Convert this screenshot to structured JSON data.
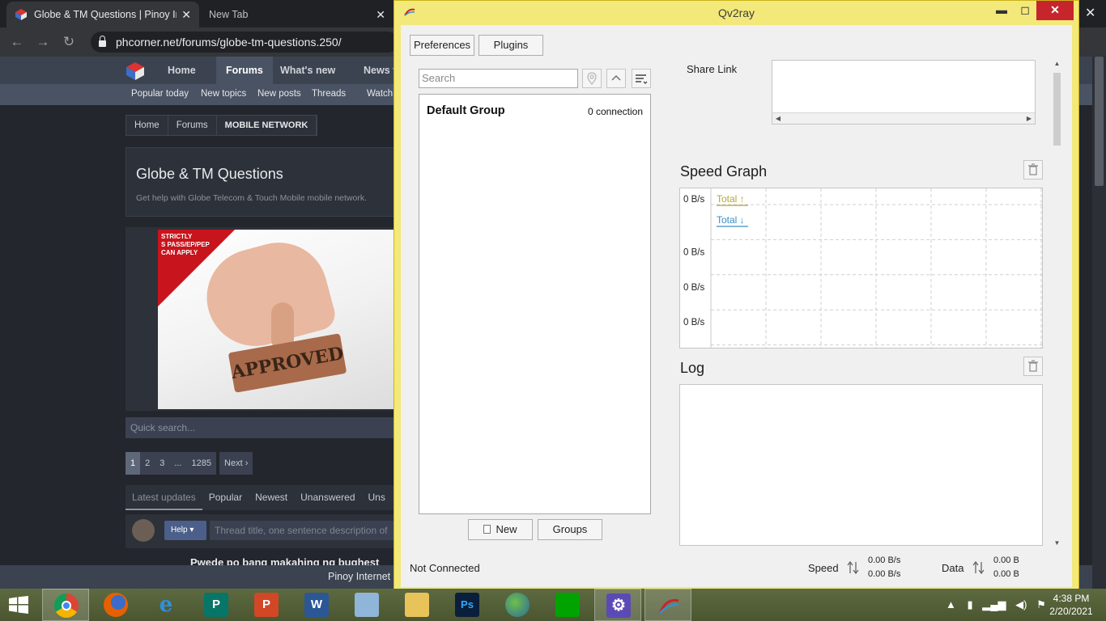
{
  "browser": {
    "tabs": [
      {
        "title": "Globe & TM Questions | Pinoy In",
        "close": "✕"
      },
      {
        "title": "New Tab",
        "close": "✕"
      }
    ],
    "url": "phcorner.net/forums/globe-tm-questions.250/",
    "nav": {
      "back": "←",
      "forward": "→",
      "reload": "↻"
    }
  },
  "site": {
    "nav": [
      "Home",
      "Forums",
      "What's new",
      "News f"
    ],
    "subnav": [
      "Popular today",
      "New topics",
      "New posts",
      "Threads",
      "Watch"
    ],
    "breadcrumb": [
      "Home",
      "Forums",
      "MOBILE NETWORK"
    ],
    "forum_title": "Globe & TM Questions",
    "forum_desc": "Get help with Globe Telecom & Touch Mobile mobile network.",
    "banner_text": "STRICTLY\nS PASS/EP/PEP\nCAN APPLY",
    "banner_stamp": "APPROVED",
    "quick_search": "Quick search...",
    "pages": [
      "1",
      "2",
      "3",
      "...",
      "1285"
    ],
    "next": "Next ›",
    "latest_tabs": [
      "Latest updates",
      "Popular",
      "Newest",
      "Unanswered",
      "Uns"
    ],
    "help_label": "Help",
    "thread_placeholder": "Thread title, one sentence description of",
    "thread_preview": "Pwede po bang makahing ng bughest",
    "footer": "Pinoy Internet c"
  },
  "qv2ray": {
    "title": "Qv2ray",
    "window_min": "▬",
    "window_max": "◻",
    "window_close": "✕",
    "preferences": "Preferences",
    "plugins": "Plugins",
    "search_placeholder": "Search",
    "group": {
      "name": "Default Group",
      "count": "0 connection"
    },
    "new_button": "New",
    "groups_button": "Groups",
    "share_link_label": "Share Link",
    "speed_graph_title": "Speed Graph",
    "log_title": "Log",
    "graph": {
      "y_labels": [
        "0 B/s",
        "0 B/s",
        "0 B/s",
        "0 B/s",
        "0 B/s"
      ],
      "legend": [
        {
          "label": "Total ↑",
          "color": "#b5a53a"
        },
        {
          "label": "Total ↓",
          "color": "#3a8fc7"
        }
      ]
    },
    "status": "Not Connected",
    "speed_label": "Speed",
    "speed_up": "0.00 B/s",
    "speed_down": "0.00 B/s",
    "data_label": "Data",
    "data_up": "0.00 B",
    "data_down": "0.00 B"
  },
  "taskbar": {
    "apps": [
      "chrome",
      "firefox",
      "internet-explorer",
      "publisher",
      "powerpoint",
      "word",
      "notepad",
      "file-explorer",
      "photoshop",
      "globe-app",
      "store",
      "settings",
      "qv2ray"
    ],
    "clock_time": "4:38 PM",
    "clock_date": "2/20/2021"
  }
}
